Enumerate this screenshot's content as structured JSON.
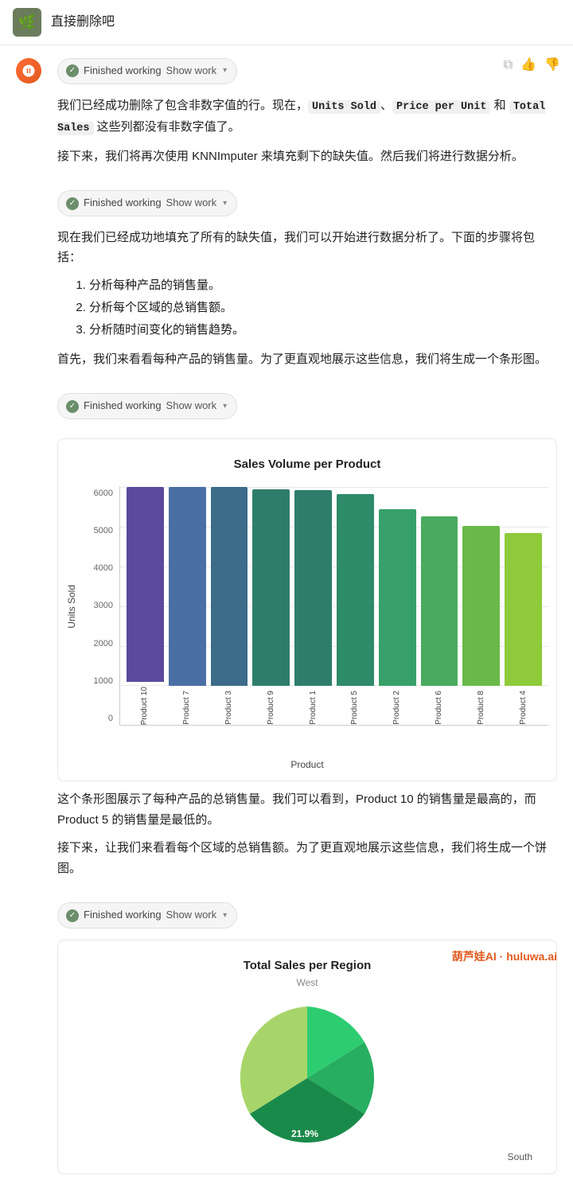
{
  "header": {
    "avatar_emoji": "🌿",
    "title": "直接删除吧"
  },
  "actions": {
    "copy_icon": "⧉",
    "thumbs_up_icon": "👍",
    "thumbs_down_icon": "👎"
  },
  "blocks": [
    {
      "id": "block1",
      "pill": {
        "finished_label": "Finished working",
        "show_work_label": "Show work"
      },
      "text_parts": [
        "我们已经成功删除了包含非数字值的行。现在，",
        "Units Sold",
        "、",
        "Price per Unit",
        " 和 ",
        "Total Sales",
        " 这些列都没有非数字值了。"
      ],
      "text2": "接下来，我们将再次使用 KNNImputer 来填充剩下的缺失值。然后我们将进行数据分析。"
    },
    {
      "id": "block2",
      "pill": {
        "finished_label": "Finished working",
        "show_work_label": "Show work"
      },
      "text1": "现在我们已经成功地填充了所有的缺失值，我们可以开始进行数据分析了。下面的步骤将包括：",
      "steps": [
        "分析每种产品的销售量。",
        "分析每个区域的总销售额。",
        "分析随时间变化的销售趋势。"
      ],
      "text2": "首先，我们来看看每种产品的销售量。为了更直观地展示这些信息，我们将生成一个条形图。"
    },
    {
      "id": "block3",
      "pill": {
        "finished_label": "Finished working",
        "show_work_label": "Show work"
      },
      "chart": {
        "title": "Sales Volume per Product",
        "y_axis_title": "Units Sold",
        "x_axis_title": "Product",
        "y_labels": [
          "6000",
          "5000",
          "4000",
          "3000",
          "2000",
          "1000",
          "0"
        ],
        "bars": [
          {
            "label": "Product 10",
            "value": 6020,
            "color": "#5b4a9e"
          },
          {
            "label": "Product 7",
            "value": 5980,
            "color": "#4a6fa5"
          },
          {
            "label": "Product 3",
            "value": 5740,
            "color": "#3d6b8a"
          },
          {
            "label": "Product 9",
            "value": 5380,
            "color": "#2e7d6a"
          },
          {
            "label": "Product 1",
            "value": 5360,
            "color": "#2e7d6a"
          },
          {
            "label": "Product 5",
            "value": 5260,
            "color": "#2e8b6a"
          },
          {
            "label": "Product 2",
            "value": 4840,
            "color": "#38a06a"
          },
          {
            "label": "Product 6",
            "value": 4640,
            "color": "#4aaa60"
          },
          {
            "label": "Product 8",
            "value": 4380,
            "color": "#6ab84a"
          },
          {
            "label": "Product 4",
            "value": 4180,
            "color": "#8eca3a"
          }
        ],
        "max_value": 6500
      },
      "text_after": "这个条形图展示了每种产品的总销售量。我们可以看到，Product 10 的销售量是最高的，而 Product 5 的销售量是最低的。",
      "text_after2": "接下来，让我们来看看每个区域的总销售额。为了更直观地展示这些信息，我们将生成一个饼图。"
    },
    {
      "id": "block4",
      "pill": {
        "finished_label": "Finished working",
        "show_work_label": "Show work"
      },
      "pie_chart": {
        "title": "Total Sales per Region",
        "subtitle": "West",
        "label_21": "21.9%",
        "south_label": "South"
      }
    }
  ],
  "watermark": {
    "brand": "葫芦娃AI · huluwa.ai"
  }
}
